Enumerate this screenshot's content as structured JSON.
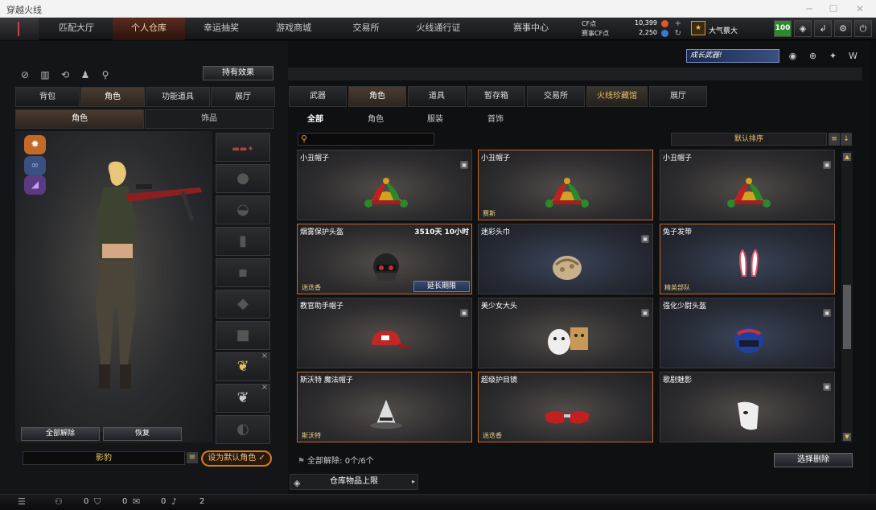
{
  "window": {
    "title": "穿越火线"
  },
  "nav": {
    "tabs": [
      "匹配大厅",
      "个人仓库",
      "幸运抽奖",
      "游戏商城",
      "交易所",
      "火线通行证",
      "赛事中心"
    ],
    "active_index": 1
  },
  "currency": {
    "cf_label": "CF点",
    "cf_value": "10,399",
    "match_label": "赛事CF点",
    "match_value": "2,250"
  },
  "user": {
    "name": "大气蔡大",
    "level_badge": "100"
  },
  "left": {
    "effects_button": "持有效果",
    "tabs": [
      "背包",
      "角色",
      "功能道具",
      "展厅"
    ],
    "active_tab": 1,
    "subtabs": [
      "角色",
      "饰品"
    ],
    "active_subtab": 0,
    "unequip_all": "全部解除",
    "restore": "恢复",
    "character_name": "影豹",
    "set_default": "设为默认角色"
  },
  "right": {
    "promo_text": "成长武器!",
    "tabs": [
      "武器",
      "角色",
      "道具",
      "暂存箱",
      "交易所",
      "火线珍藏馆",
      "展厅"
    ],
    "active_tab": 1,
    "subtabs": [
      "全部",
      "角色",
      "服装",
      "首饰"
    ],
    "active_subtab": 0,
    "search_placeholder": "",
    "sort_label": "默认排序",
    "items": [
      {
        "name": "小丑帽子",
        "tag": "",
        "days": "",
        "lock": true,
        "selected": false,
        "art": "jester"
      },
      {
        "name": "小丑帽子",
        "tag": "赛斯",
        "days": "",
        "lock": false,
        "selected": true,
        "art": "jester"
      },
      {
        "name": "小丑帽子",
        "tag": "",
        "days": "",
        "lock": true,
        "selected": false,
        "art": "jester"
      },
      {
        "name": "烟雾保护头盔",
        "tag": "迷迭香",
        "days": "3510天 10小时",
        "lock": false,
        "selected": true,
        "art": "helmet",
        "extend": "延长期限"
      },
      {
        "name": "迷彩头巾",
        "tag": "",
        "days": "",
        "lock": true,
        "selected": false,
        "art": "bandana",
        "blue": true
      },
      {
        "name": "兔子发带",
        "tag": "精英部队",
        "days": "",
        "lock": false,
        "selected": true,
        "art": "bunny",
        "blue": true
      },
      {
        "name": "教官助手帽子",
        "tag": "",
        "days": "",
        "lock": true,
        "selected": false,
        "art": "cap"
      },
      {
        "name": "美少女大头",
        "tag": "",
        "days": "",
        "lock": true,
        "selected": false,
        "art": "mask"
      },
      {
        "name": "强化少尉头盔",
        "tag": "",
        "days": "",
        "lock": true,
        "selected": false,
        "art": "racing",
        "blue": true
      },
      {
        "name": "斯沃特 魔法帽子",
        "tag": "斯沃特",
        "days": "",
        "lock": false,
        "selected": true,
        "art": "witch"
      },
      {
        "name": "超级护目镜",
        "tag": "迷迭香",
        "days": "",
        "lock": false,
        "selected": true,
        "art": "goggles"
      },
      {
        "name": "歌剧魅影",
        "tag": "",
        "days": "",
        "lock": true,
        "selected": false,
        "art": "phantom"
      }
    ],
    "unequip_summary": "全部解除:  0个/6个",
    "select_delete": "选择删除",
    "capacity_label": "仓库物品上限"
  },
  "statusbar": {
    "count1": "0",
    "count2": "0",
    "count3": "0",
    "count4": "2"
  },
  "colors": {
    "accent": "#c46a28",
    "gold": "#e8c060",
    "bg": "#0f1012"
  }
}
